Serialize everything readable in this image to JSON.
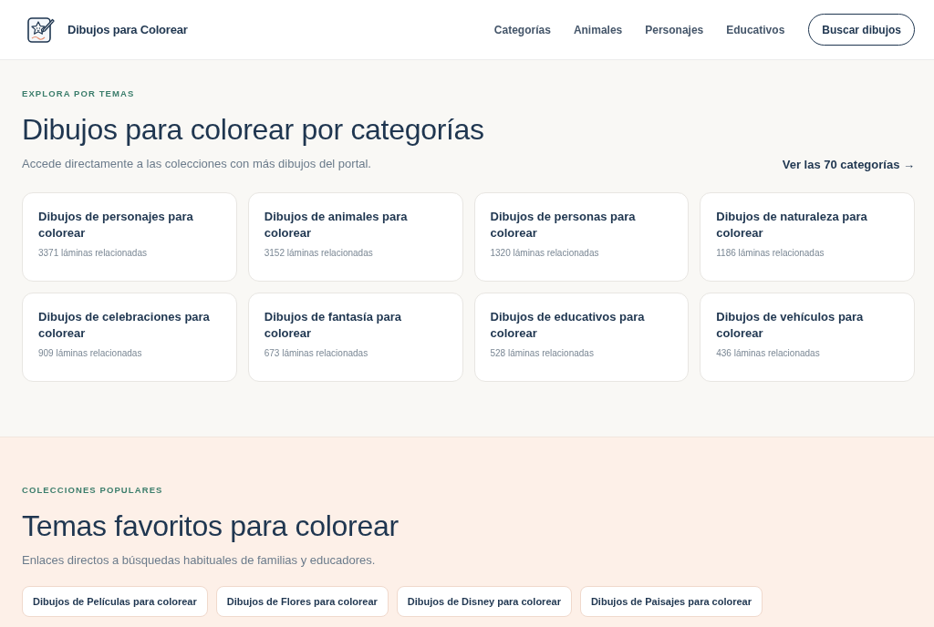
{
  "header": {
    "brand": "Dibujos para Colorear",
    "nav": [
      "Categorías",
      "Animales",
      "Personajes",
      "Educativos"
    ],
    "search_button": "Buscar dibujos"
  },
  "categories_section": {
    "eyebrow": "EXPLORA POR TEMAS",
    "title": "Dibujos para colorear por categorías",
    "subtitle": "Accede directamente a las colecciones con más dibujos del portal.",
    "link": "Ver las 70 categorías →",
    "cards": [
      {
        "title": "Dibujos de personajes para colorear",
        "count": "3371 láminas relacionadas"
      },
      {
        "title": "Dibujos de animales para colorear",
        "count": "3152 láminas relacionadas"
      },
      {
        "title": "Dibujos de personas para colorear",
        "count": "1320 láminas relacionadas"
      },
      {
        "title": "Dibujos de naturaleza para colorear",
        "count": "1186 láminas relacionadas"
      },
      {
        "title": "Dibujos de celebraciones para colorear",
        "count": "909 láminas relacionadas"
      },
      {
        "title": "Dibujos de fantasía para colorear",
        "count": "673 láminas relacionadas"
      },
      {
        "title": "Dibujos de educativos para colorear",
        "count": "528 láminas relacionadas"
      },
      {
        "title": "Dibujos de vehículos para colorear",
        "count": "436 láminas relacionadas"
      }
    ]
  },
  "popular_section": {
    "eyebrow": "COLECCIONES POPULARES",
    "title": "Temas favoritos para colorear",
    "subtitle": "Enlaces directos a búsquedas habituales de familias y educadores.",
    "chips": [
      "Dibujos de Películas para colorear",
      "Dibujos de Flores para colorear",
      "Dibujos de Disney para colorear",
      "Dibujos de Paisajes para colorear"
    ]
  }
}
